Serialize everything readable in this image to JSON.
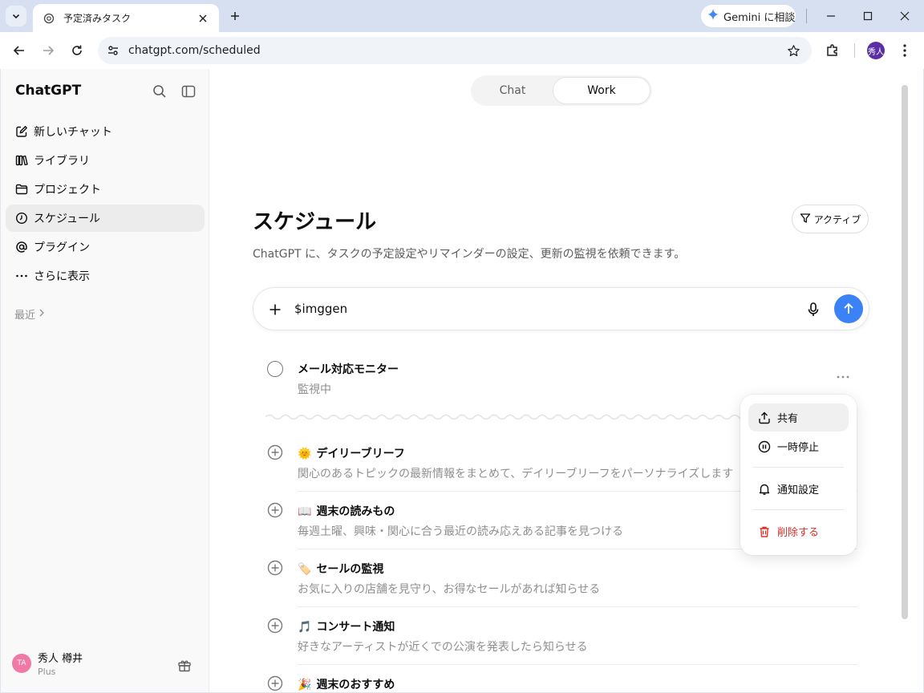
{
  "browser": {
    "tab_title": "予定済みタスク",
    "url": "chatgpt.com/scheduled",
    "gemini_label": "Gemini に相談",
    "profile_initials": "秀人"
  },
  "sidebar": {
    "brand": "ChatGPT",
    "items": [
      {
        "label": "新しいチャット",
        "icon": "edit-icon"
      },
      {
        "label": "ライブラリ",
        "icon": "library-icon"
      },
      {
        "label": "プロジェクト",
        "icon": "folder-icon"
      },
      {
        "label": "スケジュール",
        "icon": "clock-icon"
      },
      {
        "label": "プラグイン",
        "icon": "at-icon"
      },
      {
        "label": "さらに表示",
        "icon": "more-icon"
      }
    ],
    "recent_label": "最近",
    "user": {
      "initials": "TA",
      "name": "秀人 樽井",
      "plan": "Plus"
    }
  },
  "main": {
    "toggle": {
      "chat": "Chat",
      "work": "Work"
    },
    "title": "スケジュール",
    "filter_label": "アクティブ",
    "description": "ChatGPT に、タスクの予定設定やリマインダーの設定、更新の監視を依頼できます。",
    "composer_text": "$imggen",
    "task": {
      "title": "メール対応モニター",
      "status": "監視中"
    },
    "suggestions": [
      {
        "emoji": "🌞",
        "title": "デイリーブリーフ",
        "desc": "関心のあるトピックの最新情報をまとめて、デイリーブリーフをパーソナライズします"
      },
      {
        "emoji": "📖",
        "title": "週末の読みもの",
        "desc": "毎週土曜、興味・関心に合う最近の読み応えある記事を見つける"
      },
      {
        "emoji": "🏷️",
        "title": "セールの監視",
        "desc": "お気に入りの店舗を見守り、お得なセールがあれば知らせる"
      },
      {
        "emoji": "🎵",
        "title": "コンサート通知",
        "desc": "好きなアーティストが近くでの公演を発表したら知らせる"
      },
      {
        "emoji": "🎉",
        "title": "週末のおすすめ",
        "desc": ""
      }
    ],
    "menu": {
      "share": "共有",
      "pause": "一時停止",
      "notify": "通知設定",
      "delete": "削除する"
    }
  },
  "colors": {
    "accent": "#3b82f6",
    "danger": "#e02e2a",
    "avatar_user": "#f079a6",
    "avatar_profile": "#5a2fa3"
  }
}
